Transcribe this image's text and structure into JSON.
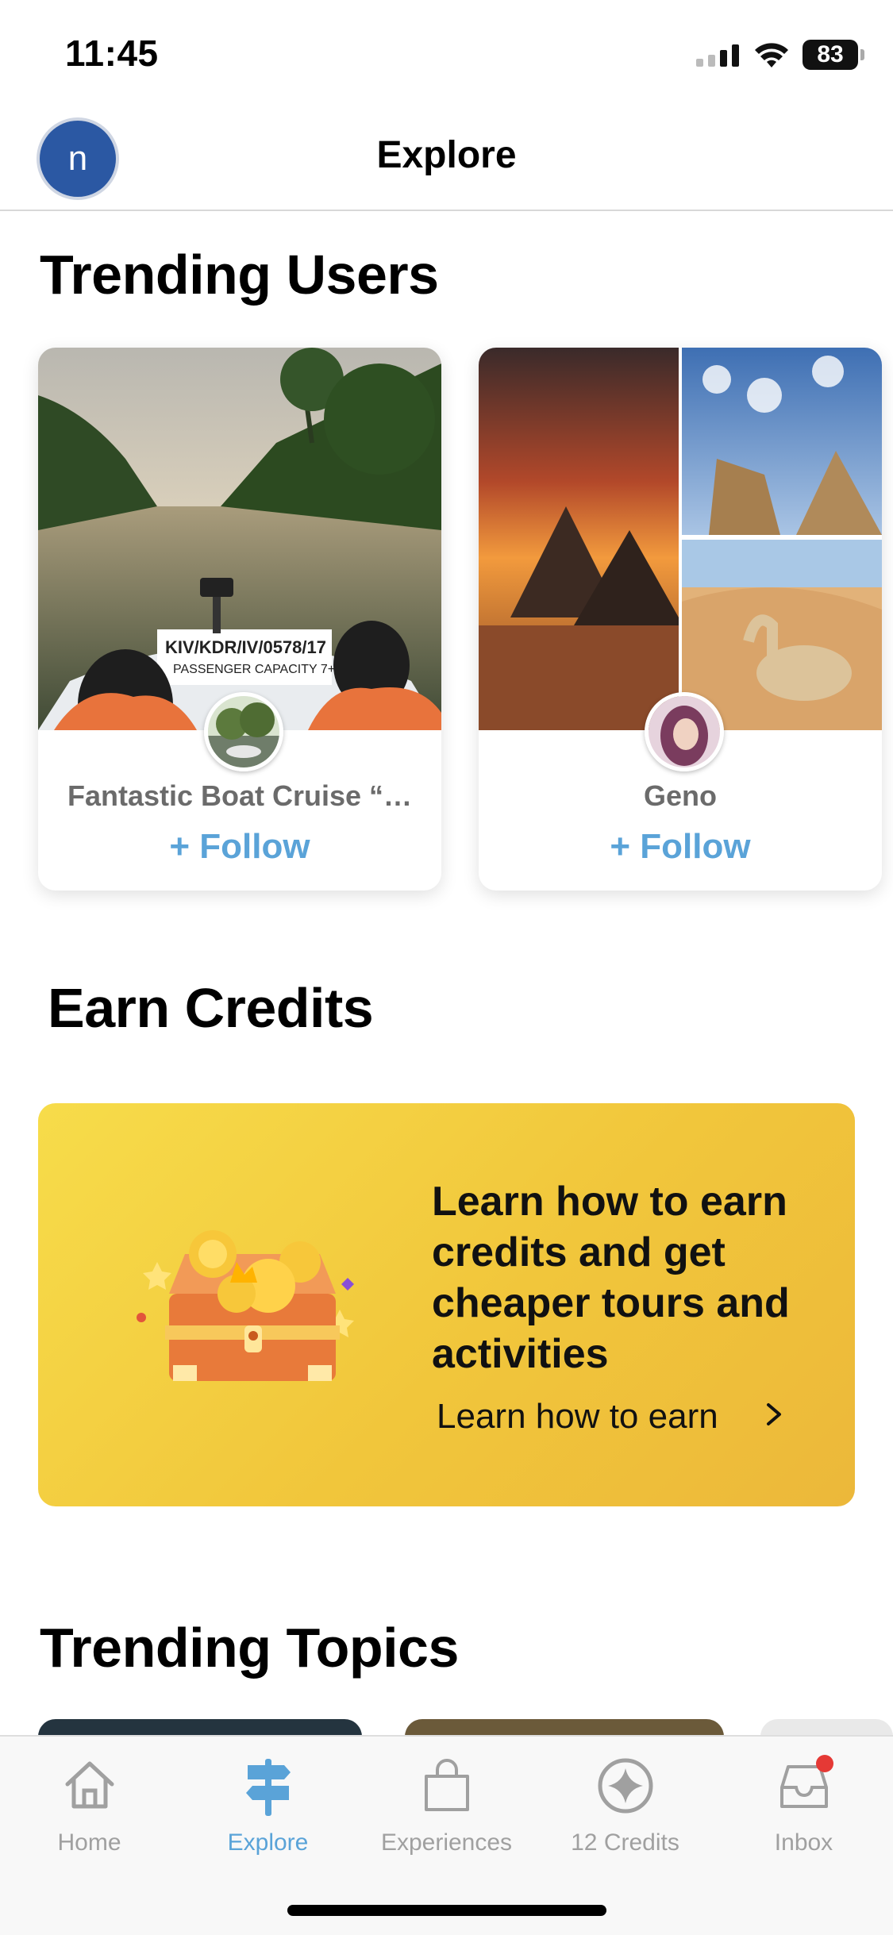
{
  "status_bar": {
    "time": "11:45",
    "battery": "83"
  },
  "header": {
    "avatar_initial": "n",
    "title": "Explore"
  },
  "trending_users": {
    "title": "Trending Users",
    "cards": [
      {
        "name": "Fantastic Boat Cruise “…",
        "follow_label": "+ Follow"
      },
      {
        "name": "Geno",
        "follow_label": "+ Follow"
      }
    ]
  },
  "earn_credits": {
    "title": "Earn Credits",
    "headline": "Learn how to earn credits and get cheaper tours and activities",
    "link_label": "Learn how to earn"
  },
  "trending_topics": {
    "title": "Trending Topics"
  },
  "tab_bar": {
    "tabs": [
      {
        "label": "Home",
        "icon": "home-icon",
        "active": false
      },
      {
        "label": "Explore",
        "icon": "signpost-icon",
        "active": true
      },
      {
        "label": "Experiences",
        "icon": "shopping-bag-icon",
        "active": false
      },
      {
        "label": "12 Credits",
        "icon": "credits-star-icon",
        "active": false
      },
      {
        "label": "Inbox",
        "icon": "inbox-icon",
        "active": false
      }
    ]
  },
  "colors": {
    "accent": "#5aa3d8",
    "avatar": "#2b58a3",
    "banner": "#f3cc3f",
    "notification": "#e53935"
  }
}
